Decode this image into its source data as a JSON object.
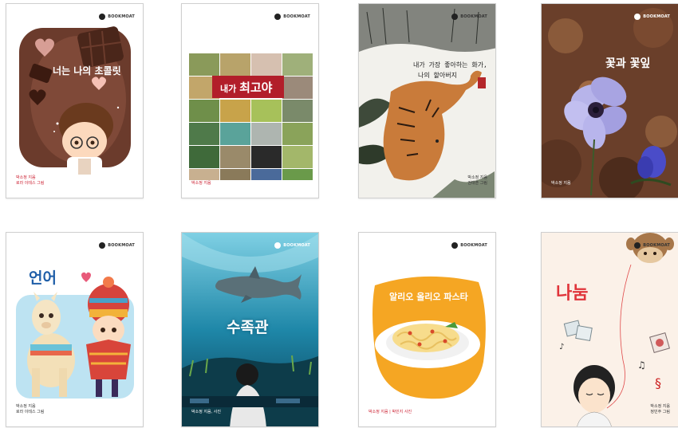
{
  "publisher": "BOOKMOAT",
  "books": [
    {
      "title": "너는 나의 초콜릿",
      "author_line": "박소정 지음",
      "illustrator_line": "로라 이테스 그림"
    },
    {
      "title_prefix": "내가 ",
      "title_main": "최고야",
      "author_line": "박소정 지음"
    },
    {
      "title_line1": "내가 가장 좋아하는 화가,",
      "title_line2": "나의 할아버지",
      "author_line": "박소정 지음",
      "illustrator_line": "권태훈 그림"
    },
    {
      "title": "꽃과 꽃잎",
      "author_line": "박소정 지음"
    },
    {
      "title": "언어",
      "author_line": "박소정 지음",
      "illustrator_line": "로라 이테스 그림"
    },
    {
      "title": "수족관",
      "author_line": "박소정 지음, 사진"
    },
    {
      "title": "알리오 올리오 파스타",
      "author_line": "박소정 지음  |  박민지 사진"
    },
    {
      "title": "나눔",
      "author_line": "박소정 지음",
      "illustrator_line": "정민주 그림"
    }
  ]
}
